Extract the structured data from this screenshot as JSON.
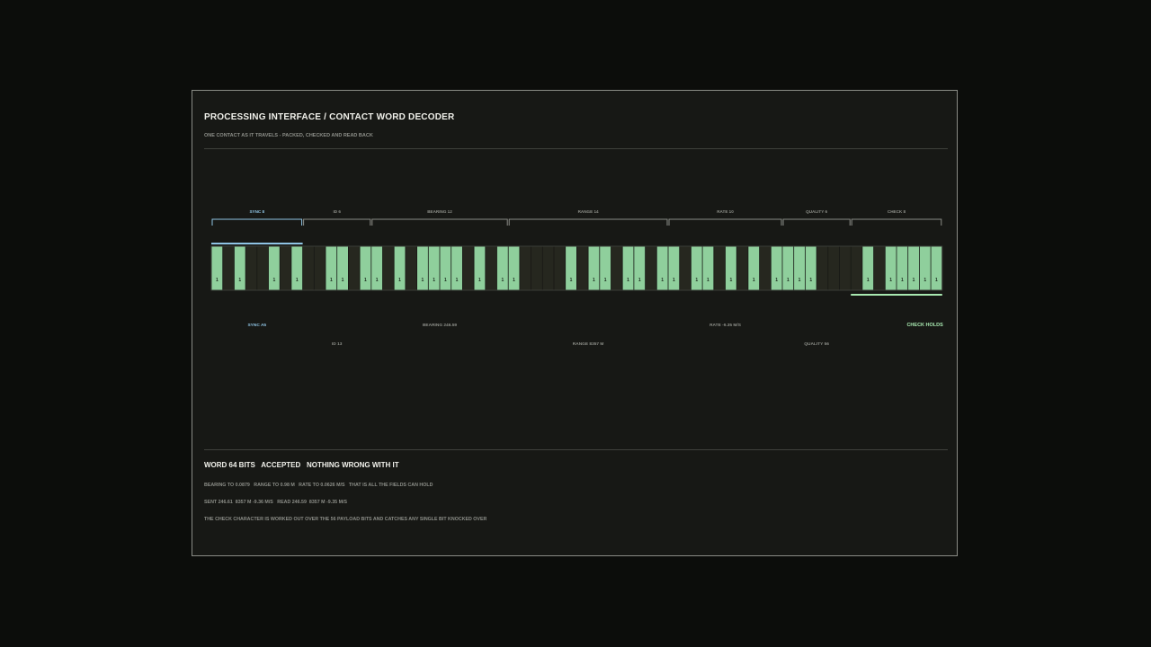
{
  "header": {
    "title": "PROCESSING INTERFACE / CONTACT WORD DECODER",
    "subtitle": "ONE CONTACT AS IT TRAVELS - PACKED, CHECKED AND READ BACK"
  },
  "colors": {
    "sync": "#8fc4e4",
    "bit_on": "#8fcf9c",
    "bit_off": "#26271f",
    "bracket": "#8a8c86",
    "check_ok": "#a8e8b0"
  },
  "fields": [
    {
      "label": "SYNC 8",
      "readout": "SYNC A5",
      "bits": "10100101",
      "highlight": "sync"
    },
    {
      "label": "ID 6",
      "readout": "ID 13",
      "bits": "001101"
    },
    {
      "label": "BEARING 12",
      "readout": "BEARING 246.59",
      "bits": "101011110101"
    },
    {
      "label": "RANGE 14",
      "readout": "RANGE  8357 M",
      "bits": "10000101101101"
    },
    {
      "label": "RATE 10",
      "readout": "RATE -9.35 M/S",
      "bits": "1011010101"
    },
    {
      "label": "QUALITY 6",
      "readout": "QUALITY 56",
      "bits": "111000"
    },
    {
      "label": "CHECK 8",
      "readout": "CHECK HOLDS",
      "bits": "01011111",
      "highlight": "check"
    }
  ],
  "summary": {
    "word_bits": "WORD 64 BITS",
    "status": "ACCEPTED",
    "verdict": "NOTHING WRONG WITH IT",
    "limits": "BEARING TO 0.0879   RANGE TO 0.98 M   RATE TO 0.0626 M/S   THAT IS ALL THE FIELDS CAN HOLD",
    "sent_read": "SENT 246.61  8357 M -9.36 M/S   READ 246.59  8357 M -9.35 M/S",
    "note": "THE CHECK CHARACTER IS WORKED OUT OVER THE 56 PAYLOAD BITS AND CATCHES ANY SINGLE BIT KNOCKED OVER"
  }
}
